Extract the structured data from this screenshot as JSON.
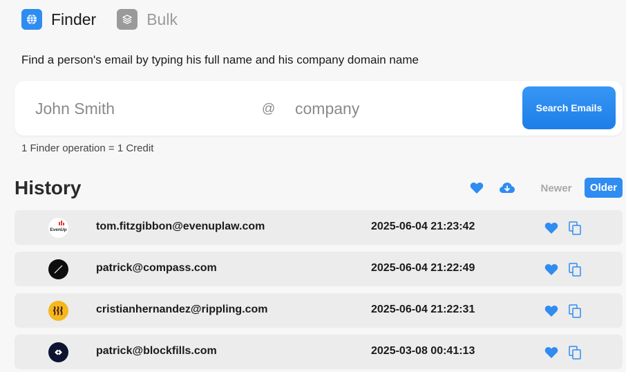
{
  "tabs": {
    "finder_label": "Finder",
    "bulk_label": "Bulk"
  },
  "instruction": "Find a person's email by typing his full name and his company domain name",
  "search": {
    "name_placeholder": "John Smith",
    "at_symbol": "@",
    "domain_placeholder": "company",
    "button_label": "Search Emails"
  },
  "credit_note": "1 Finder operation = 1 Credit",
  "history": {
    "title": "History",
    "sort_newer": "Newer",
    "sort_older": "Older",
    "active_sort": "Older",
    "rows": [
      {
        "logo": "evenup-logo",
        "logo_text": "EvenUp",
        "email": "tom.fitzgibbon@evenuplaw.com",
        "date": "2025-06-04 21:23:42"
      },
      {
        "logo": "compass-logo",
        "email": "patrick@compass.com",
        "date": "2025-06-04 21:22:49"
      },
      {
        "logo": "rippling-logo",
        "email": "cristianhernandez@rippling.com",
        "date": "2025-06-04 21:22:31"
      },
      {
        "logo": "blockfills-logo",
        "email": "patrick@blockfills.com",
        "date": "2025-03-08 00:41:13"
      }
    ]
  },
  "colors": {
    "accent": "#2f8cf0",
    "inactive": "#9a9a9a",
    "row_bg": "#ececec",
    "page_bg": "#f7f7f7"
  }
}
